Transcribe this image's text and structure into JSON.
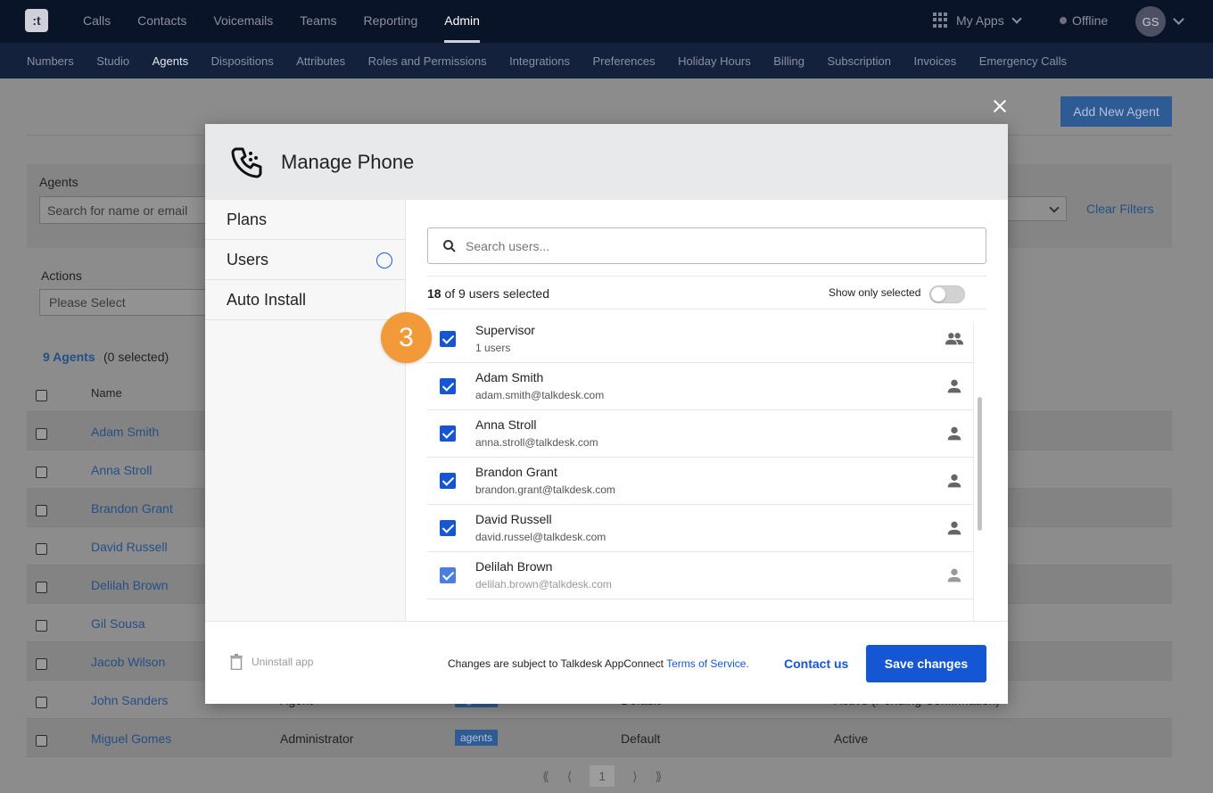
{
  "app": {
    "logo_text": ":t"
  },
  "topnav": {
    "items": [
      "Calls",
      "Contacts",
      "Voicemails",
      "Teams",
      "Reporting",
      "Admin"
    ],
    "active": "Admin",
    "my_apps": "My Apps",
    "status": "Offline",
    "avatar": "GS"
  },
  "subnav": {
    "items": [
      "Numbers",
      "Studio",
      "Agents",
      "Dispositions",
      "Attributes",
      "Roles and Permissions",
      "Integrations",
      "Preferences",
      "Holiday Hours",
      "Billing",
      "Subscription",
      "Invoices",
      "Emergency Calls"
    ],
    "active": "Agents"
  },
  "page": {
    "add_agent": "Add New Agent",
    "agents_label": "Agents",
    "search_placeholder": "Search for name or email",
    "clear_filters": "Clear Filters",
    "actions_label": "Actions",
    "actions_value": "Please Select",
    "agents_count": "9 Agents",
    "agents_selected": "(0 selected)",
    "table_header_name": "Name",
    "rows": [
      {
        "name": "Adam Smith"
      },
      {
        "name": "Anna Stroll"
      },
      {
        "name": "Brandon Grant"
      },
      {
        "name": "David Russell"
      },
      {
        "name": "Delilah Brown"
      },
      {
        "name": "Gil Sousa"
      },
      {
        "name": "Jacob Wilson"
      },
      {
        "name": "John Sanders",
        "role": "Agent",
        "tag": "agents",
        "ring": "Default",
        "status": "Active (Pending Confirmation)"
      },
      {
        "name": "Miguel Gomes",
        "role": "Administrator",
        "tag": "agents",
        "ring": "Default",
        "status": "Active"
      }
    ],
    "pager": {
      "first": "⟪",
      "prev": "⟨",
      "current": "1",
      "next": "⟩",
      "last": "⟫"
    }
  },
  "modal": {
    "title": "Manage Phone",
    "menu": [
      "Plans",
      "Users",
      "Auto Install"
    ],
    "search_placeholder": "Search users...",
    "selected_count": "18",
    "selected_text": " of 9 users selected",
    "show_only": "Show only selected",
    "users": [
      {
        "name": "Supervisor",
        "sub": "1 users",
        "icon": "group-icon"
      },
      {
        "name": "Adam Smith",
        "sub": "adam.smith@talkdesk.com",
        "icon": "person-icon"
      },
      {
        "name": "Anna Stroll",
        "sub": "anna.stroll@talkdesk.com",
        "icon": "person-icon"
      },
      {
        "name": "Brandon Grant",
        "sub": "brandon.grant@talkdesk.com",
        "icon": "person-icon"
      },
      {
        "name": "David Russell",
        "sub": "david.russel@talkdesk.com",
        "icon": "person-icon"
      },
      {
        "name": "Delilah Brown",
        "sub": "delilah.brown@talkdesk.com",
        "icon": "person-icon"
      }
    ],
    "step_badge": "3",
    "footer": {
      "uninstall": "Uninstall app",
      "terms_prefix": "Changes are subject to Talkdesk AppConnect ",
      "terms_link": "Terms of Service.",
      "contact": "Contact us",
      "save": "Save changes"
    }
  },
  "colors": {
    "accent": "#1556d4",
    "badge": "#f29a39",
    "nav_bg": "#0a1428"
  }
}
